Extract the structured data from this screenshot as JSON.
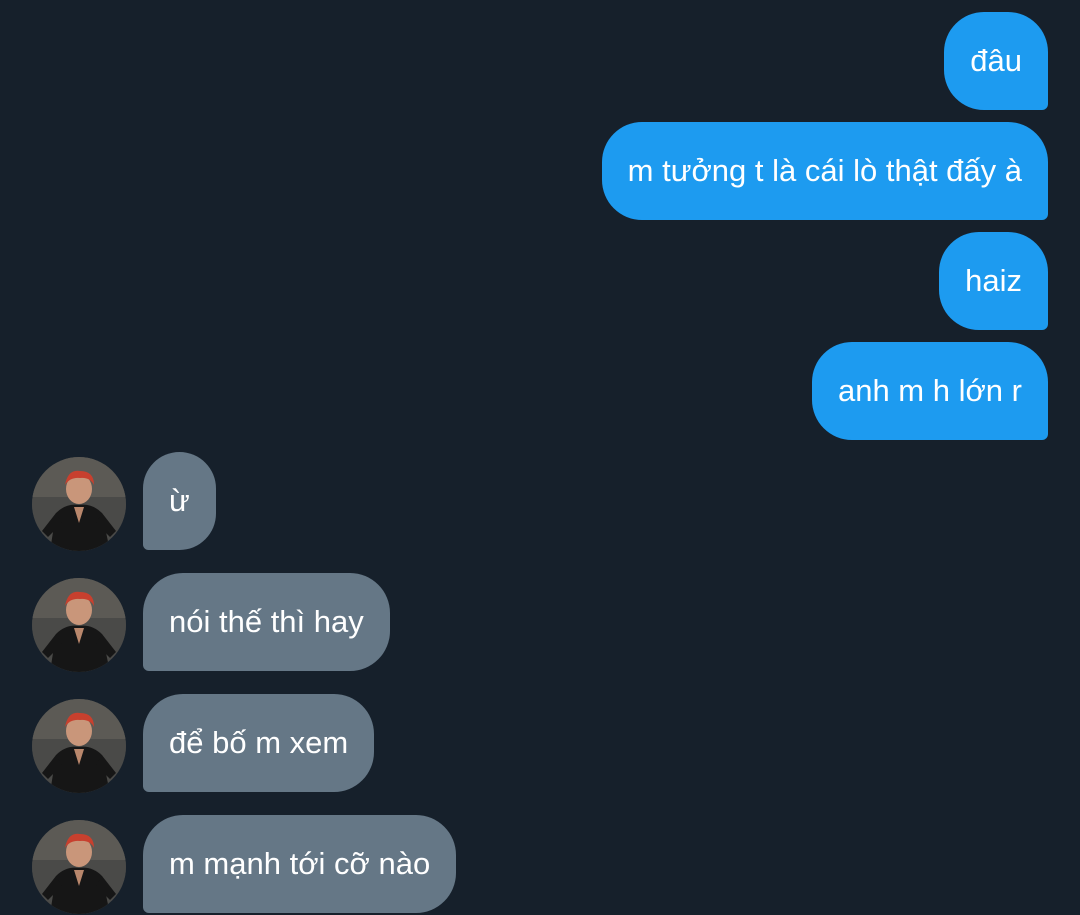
{
  "conversation": {
    "outgoing": [
      {
        "text": "đâu"
      },
      {
        "text": "m tưởng t là cái lò thật đấy à"
      },
      {
        "text": "haiz"
      },
      {
        "text": "anh m h lớn r"
      }
    ],
    "incoming": [
      {
        "text": "ừ",
        "avatar_icon": "user-avatar-icon"
      },
      {
        "text": "nói thế thì hay",
        "avatar_icon": "user-avatar-icon"
      },
      {
        "text": "để bố m xem",
        "avatar_icon": "user-avatar-icon"
      },
      {
        "text": "m mạnh tới cỡ nào",
        "avatar_icon": "user-avatar-icon"
      }
    ]
  },
  "colors": {
    "background": "#16202b",
    "outgoing_bubble": "#1d9bf0",
    "incoming_bubble": "#657786",
    "text": "#ffffff"
  }
}
